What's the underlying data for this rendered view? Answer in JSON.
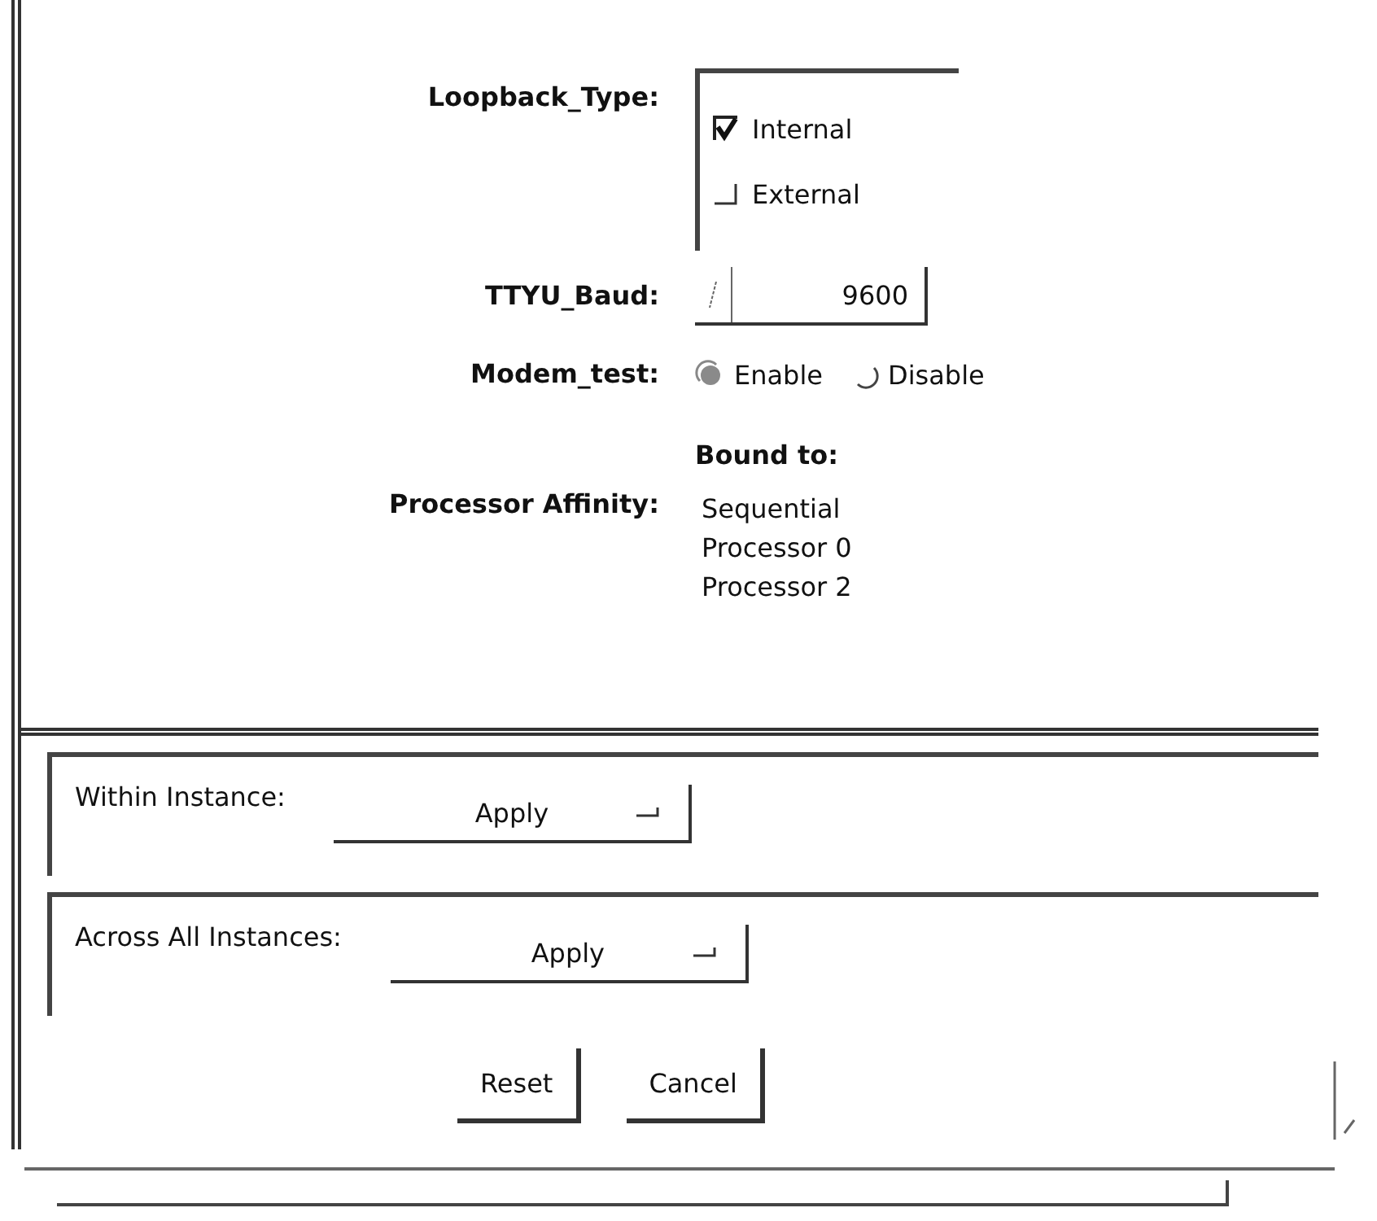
{
  "fields": [
    {
      "kind": "checkboxes",
      "label": "Loopback_Type:",
      "options": [
        {
          "label": "Internal",
          "checked": true
        },
        {
          "label": "External",
          "checked": false
        }
      ]
    },
    {
      "kind": "option_menu",
      "label": "TTYU_Baud:",
      "value": "9600"
    },
    {
      "kind": "radios",
      "label": "Modem_test:",
      "options": [
        {
          "label": "Enable",
          "selected": true
        },
        {
          "label": "Disable",
          "selected": false
        }
      ]
    },
    {
      "kind": "list",
      "label": "Processor Affinity:",
      "heading": "Bound to:",
      "items": [
        "Sequential",
        "Processor 0",
        "Processor 2"
      ]
    }
  ],
  "apply_panels": [
    {
      "label": "Within Instance:",
      "value": "Apply"
    },
    {
      "label": "Across All Instances:",
      "value": "Apply"
    }
  ],
  "buttons": [
    "Reset",
    "Cancel"
  ]
}
